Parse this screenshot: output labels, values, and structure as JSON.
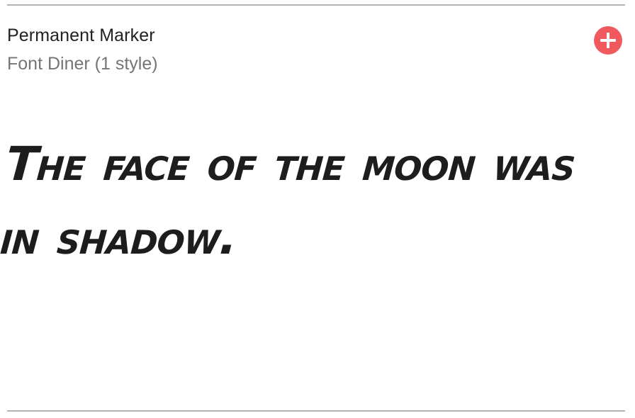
{
  "card": {
    "font_name": "Permanent Marker",
    "font_meta": "Font Diner (1 style)",
    "add_button_icon": "plus-icon",
    "accent_color": "#f05a5f",
    "sample_text": "The face of the moon was in shadow."
  }
}
